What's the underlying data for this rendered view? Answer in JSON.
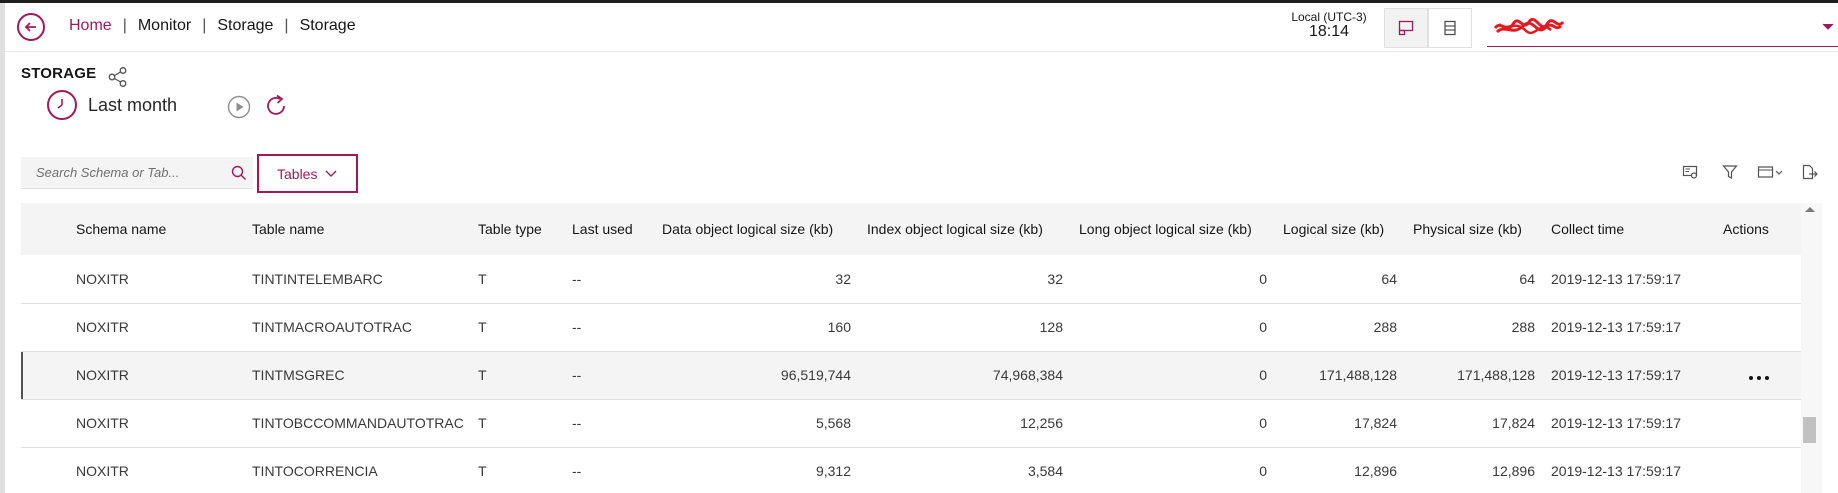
{
  "header": {
    "breadcrumb": [
      "Home",
      "Monitor",
      "Storage",
      "Storage"
    ],
    "separator": "|",
    "timezone_label": "Local (UTC-3)",
    "time": "18:14"
  },
  "page": {
    "title": "STORAGE",
    "time_range": "Last month"
  },
  "toolbar": {
    "search_placeholder": "Search Schema or Tab...",
    "tables_dropdown": "Tables"
  },
  "table": {
    "columns": [
      "Schema name",
      "Table name",
      "Table type",
      "Last used",
      "Data object logical size (kb)",
      "Index object logical size (kb)",
      "Long object logical size (kb)",
      "Logical size (kb)",
      "Physical size (kb)",
      "Collect time",
      "Actions"
    ],
    "rows": [
      [
        "NOXITR",
        "TINTINTELEMBARC",
        "T",
        "--",
        "32",
        "32",
        "0",
        "64",
        "64",
        "2019-12-13 17:59:17"
      ],
      [
        "NOXITR",
        "TINTMACROAUTOTRAC",
        "T",
        "--",
        "160",
        "128",
        "0",
        "288",
        "288",
        "2019-12-13 17:59:17"
      ],
      [
        "NOXITR",
        "TINTMSGREC",
        "T",
        "--",
        "96,519,744",
        "74,968,384",
        "0",
        "171,488,128",
        "171,488,128",
        "2019-12-13 17:59:17"
      ],
      [
        "NOXITR",
        "TINTOBCCOMMANDAUTOTRAC",
        "T",
        "--",
        "5,568",
        "12,256",
        "0",
        "17,824",
        "17,824",
        "2019-12-13 17:59:17"
      ],
      [
        "NOXITR",
        "TINTOCORRENCIA",
        "T",
        "--",
        "9,312",
        "3,584",
        "0",
        "12,896",
        "12,896",
        "2019-12-13 17:59:17"
      ]
    ],
    "highlighted_row": 2
  },
  "colors": {
    "accent": "#a2195b",
    "header_bg": "#f4f4f4",
    "text": "#161616"
  },
  "icons": [
    "back-arrow-icon",
    "dashboard-view-icon",
    "list-view-icon",
    "chevron-down-icon",
    "share-icon",
    "clock-icon",
    "play-icon",
    "refresh-icon",
    "search-icon",
    "settings-view-icon",
    "filter-icon",
    "column-settings-icon",
    "export-icon",
    "overflow-menu-icon"
  ]
}
